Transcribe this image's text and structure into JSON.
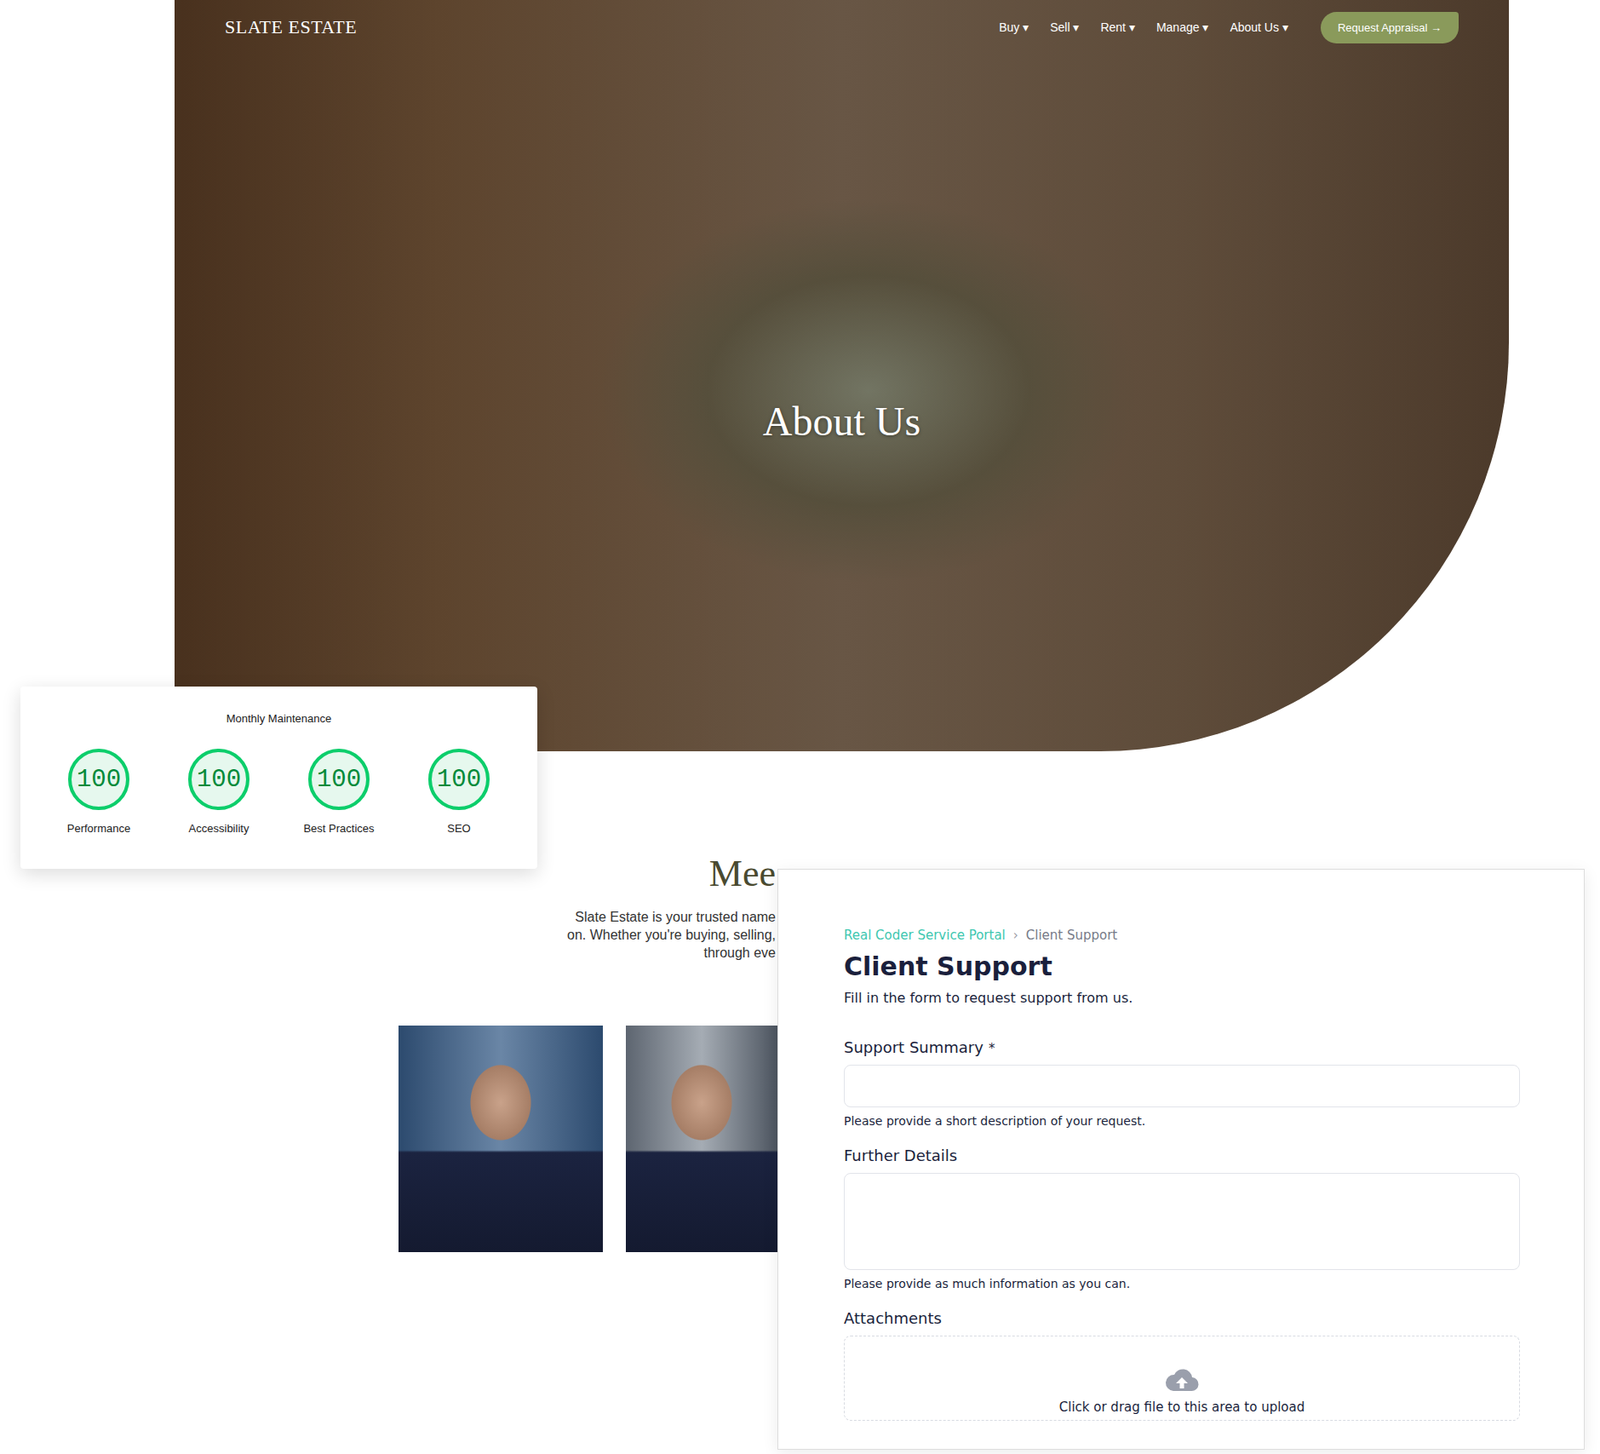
{
  "site": {
    "logo": "SLATE ESTATE",
    "nav": [
      {
        "label": "Buy",
        "caret": "▾"
      },
      {
        "label": "Sell",
        "caret": "▾"
      },
      {
        "label": "Rent",
        "caret": "▾"
      },
      {
        "label": "Manage",
        "caret": "▾"
      },
      {
        "label": "About Us",
        "caret": "▾"
      }
    ],
    "cta": "Request Appraisal →",
    "hero_title": "About Us"
  },
  "intro": {
    "heading": "Mee",
    "lines": [
      "Slate Estate is your trusted name",
      "on. Whether you're buying, selling,",
      "through eve"
    ]
  },
  "scores": {
    "title": "Monthly Maintenance",
    "items": [
      {
        "label": "Performance",
        "value": "100",
        "level": 1
      },
      {
        "label": "Accessibility",
        "value": "100",
        "level": 1
      },
      {
        "label": "Best Practices",
        "value": "100",
        "level": 1
      },
      {
        "label": "SEO",
        "value": "100",
        "level": 1
      }
    ]
  },
  "support": {
    "breadcrumb": [
      {
        "label": "Real Coder Service Portal",
        "link": true
      },
      {
        "label": "Client Support",
        "link": false
      }
    ],
    "separator": "›",
    "title": "Client Support",
    "subtitle": "Fill in the form to request support from us.",
    "required_mark": "*",
    "fields": [
      {
        "kind": "input",
        "label": "Support Summary",
        "required": true,
        "help": "Please provide a short description of your request."
      },
      {
        "kind": "textarea",
        "label": "Further Details",
        "required": false,
        "help": "Please provide as much information as you can."
      },
      {
        "kind": "upload",
        "label": "Attachments",
        "required": false,
        "help": "Click or drag file to this area to upload"
      }
    ]
  }
}
